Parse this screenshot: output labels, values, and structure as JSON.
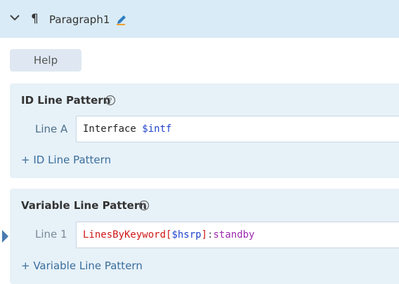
{
  "header": {
    "title": "Paragraph1",
    "paragraph_icon": "¶",
    "expand_icon": "chevron-down",
    "edit_icon": "pencil"
  },
  "help_button": {
    "label": "Help"
  },
  "id_section": {
    "title": "ID Line Pattern",
    "lines": [
      {
        "label": "Line A",
        "tokens": [
          {
            "text": "Interface ",
            "color": "#222222"
          },
          {
            "text": "$intf",
            "color": "#2244cc"
          }
        ]
      }
    ],
    "add_label": "+ ID Line Pattern"
  },
  "variable_section": {
    "title": "Variable Line Pattern",
    "lines": [
      {
        "label": "Line 1",
        "tokens": [
          {
            "text": "LinesByKeyword",
            "color": "#d01818"
          },
          {
            "text": "[",
            "color": "#d01818"
          },
          {
            "text": "$hsrp",
            "color": "#2244cc"
          },
          {
            "text": "]",
            "color": "#d01818"
          },
          {
            "text": ":",
            "color": "#555555"
          },
          {
            "text": "standby",
            "color": "#9b2bb0"
          }
        ]
      }
    ],
    "add_label": "+ Variable Line Pattern"
  },
  "colors": {
    "header_bg": "#d9ebf6",
    "section_bg": "#e7f1f8",
    "accent": "#3a6e9c",
    "pencil": "#2f7ec1"
  }
}
